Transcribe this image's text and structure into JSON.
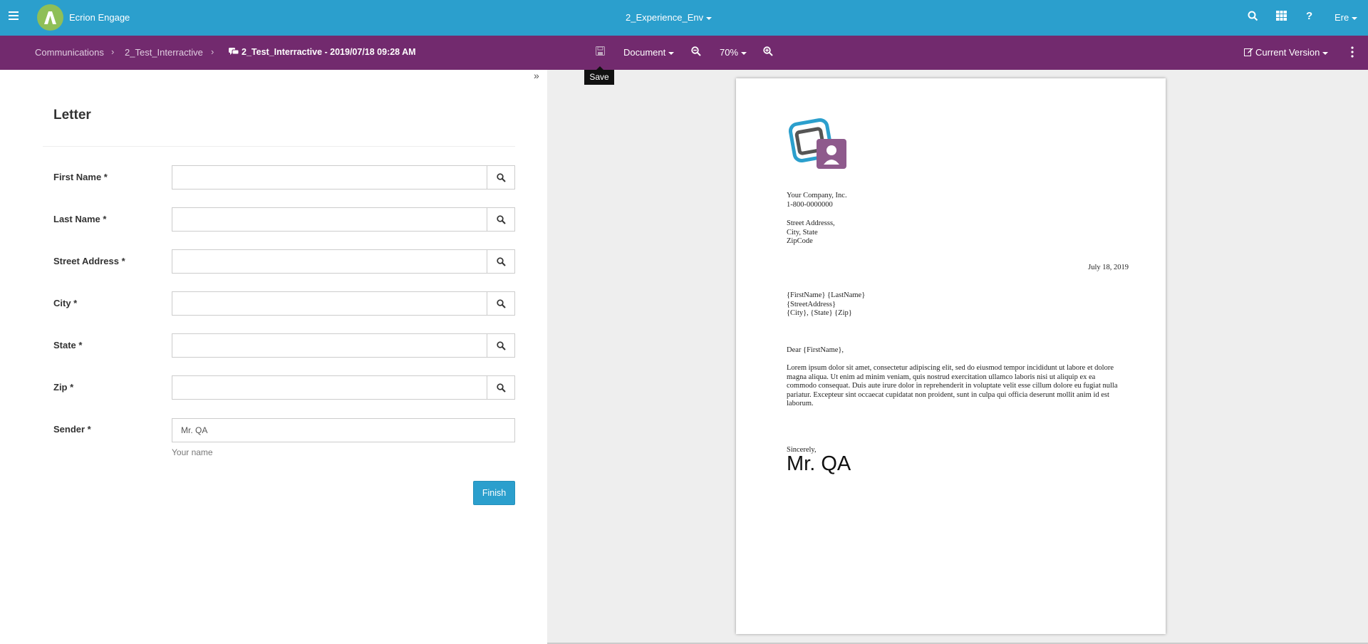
{
  "topbar": {
    "app_title": "Ecrion Engage",
    "environment": "2_Experience_Env",
    "user": "Ere",
    "icons": [
      "menu-icon",
      "search-icon",
      "grid-icon",
      "help-icon"
    ]
  },
  "subbar": {
    "breadcrumb": [
      "Communications",
      "2_Test_Interractive"
    ],
    "current": "2_Test_Interractive - 2019/07/18 09:28 AM",
    "document_label": "Document",
    "zoom": "70%",
    "version_label": "Current Version",
    "save_tooltip": "Save"
  },
  "form": {
    "title": "Letter",
    "fields": [
      {
        "label": "First Name *",
        "value": ""
      },
      {
        "label": "Last Name *",
        "value": ""
      },
      {
        "label": "Street Address *",
        "value": ""
      },
      {
        "label": "City *",
        "value": ""
      },
      {
        "label": "State *",
        "value": ""
      },
      {
        "label": "Zip *",
        "value": ""
      }
    ],
    "sender_label": "Sender *",
    "sender_value": "Mr. QA",
    "sender_help": "Your name",
    "finish_label": "Finish"
  },
  "letter": {
    "company": "Your Company, Inc.",
    "phone": "1-800-0000000",
    "street": "Street Addresss,",
    "city_state": "City, State",
    "zip": "ZipCode",
    "date": "July 18, 2019",
    "recipient_name": "{FirstName} {LastName}",
    "recipient_street": "{StreetAddress}",
    "recipient_city": "{City}, {State} {Zip}",
    "salutation": "Dear {FirstName},",
    "body": "Lorem ipsum dolor sit amet, consectetur adipiscing elit, sed do eiusmod tempor incididunt ut labore et dolore magna aliqua. Ut enim ad minim veniam, quis nostrud exercitation ullamco laboris nisi ut aliquip ex ea commodo consequat. Duis aute irure dolor in reprehenderit in voluptate velit esse cillum dolore eu fugiat nulla pariatur. Excepteur sint occaecat cupidatat non proident, sunt in culpa qui officia deserunt mollit anim id est laborum.",
    "closing": "Sincerely,",
    "signature": "Mr. QA"
  },
  "colors": {
    "topbar": "#2b9fcd",
    "subbar": "#722a6e",
    "accent": "#2b9fcd",
    "logo_green": "#8fbf57"
  }
}
